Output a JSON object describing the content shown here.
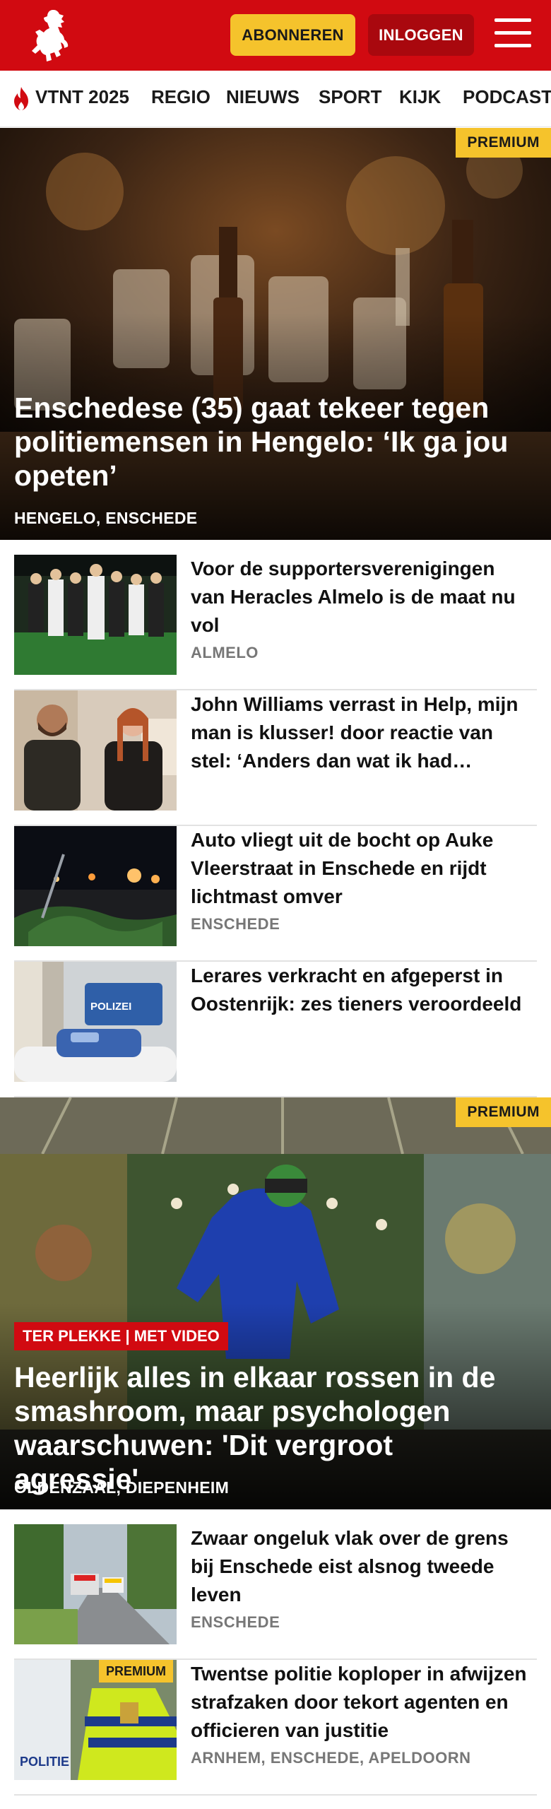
{
  "header": {
    "subscribe_label": "ABONNEREN",
    "login_label": "INLOGGEN",
    "brand_color": "#d10a11",
    "accent_color": "#f5c32c"
  },
  "nav": {
    "items": [
      "VTNT 2025",
      "REGIO",
      "NIEUWS",
      "SPORT",
      "KIJK",
      "PODCAST"
    ]
  },
  "hero1": {
    "badge": "PREMIUM",
    "title": "Enschedese (35) gaat tekeer tegen politiemensen in Hengelo: ‘Ik ga jou opeten’",
    "location": "HENGELO, ENSCHEDE"
  },
  "list1": [
    {
      "title": "Voor de supportersverenigingen van Heracles Almelo is de maat nu vol",
      "location": "ALMELO"
    },
    {
      "title": "John Williams verrast in Help, mijn man is klusser! door reactie van stel: ‘Anders dan wat ik had…",
      "location": ""
    },
    {
      "title": "Auto vliegt uit de bocht op Auke Vleerstraat in Enschede en rijdt lichtmast omver",
      "location": "ENSCHEDE"
    },
    {
      "title": "Lerares verkracht en afgeperst in Oostenrijk: zes tieners veroor­deeld",
      "location": ""
    }
  ],
  "hero2": {
    "badge": "PREMIUM",
    "kicker": "TER PLEKKE | MET VIDEO",
    "title": "Heerlijk alles in elkaar rossen in de smashroom, maar psychologen waarschuwen: 'Dit vergroot agressie'",
    "location": "OLDENZAAL, DIEPENHEIM"
  },
  "list2": [
    {
      "title": "Zwaar ongeluk vlak over de grens bij Enschede eist alsnog tweede leven",
      "location": "ENSCHEDE",
      "badge": ""
    },
    {
      "title": "Twentse politie koploper in afwijzen strafzaken door tekort agenten en officieren van justitie",
      "location": "ARNHEM, ENSCHEDE, APELDOORN",
      "badge": "PREMIUM"
    }
  ],
  "thumb_text": {
    "polizei": "POLIZEI",
    "politie": "POLITIE"
  }
}
